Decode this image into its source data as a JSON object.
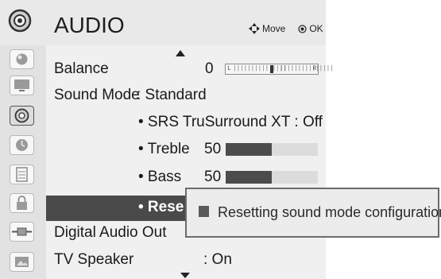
{
  "header": {
    "title": "AUDIO",
    "icon": "audio-icon",
    "nav_move": "Move",
    "nav_ok": "OK"
  },
  "sidebar": {
    "items": [
      {
        "icon": "picture-icon"
      },
      {
        "icon": "tv-screen-icon"
      },
      {
        "icon": "audio-icon",
        "active": true
      },
      {
        "icon": "time-icon"
      },
      {
        "icon": "option-icon"
      },
      {
        "icon": "lock-icon"
      },
      {
        "icon": "input-icon"
      },
      {
        "icon": "photo-icon"
      }
    ]
  },
  "menu": {
    "balance": {
      "label": "Balance",
      "value": "0",
      "slider_left": "L",
      "slider_right": "R"
    },
    "sound_mode": {
      "label": "Sound Mode",
      "value": ": Standard"
    },
    "srs": {
      "label": "• SRS TruSurround XT : Off"
    },
    "treble": {
      "label": "• Treble",
      "value": "50",
      "level": 0.5
    },
    "bass": {
      "label": "• Bass",
      "value": "50",
      "level": 0.5
    },
    "reset": {
      "label": "• Rese"
    },
    "digital_audio_out": {
      "label": "Digital Audio Out"
    },
    "tv_speaker": {
      "label": "TV Speaker",
      "value": ": On"
    }
  },
  "popup": {
    "text": "Resetting sound mode configuration..."
  },
  "colors": {
    "highlight": "#4a4a4a",
    "bar_fill": "#4c4c4c",
    "menu_bg": "#f0f0f0"
  }
}
